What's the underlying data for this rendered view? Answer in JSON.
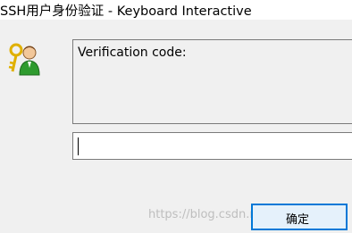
{
  "window": {
    "title": "SSH用户身份验证 - Keyboard Interactive"
  },
  "prompt": {
    "label": "Verification code:"
  },
  "code_input": {
    "value": ""
  },
  "buttons": {
    "ok_label": "确定"
  },
  "watermark": {
    "text": "https://blog.csdn.net/eyeofeagle"
  },
  "icons": {
    "auth_icon": "key-user-icon"
  },
  "colors": {
    "button_border": "#0078d7",
    "button_fill": "#e5f1fb",
    "user_green": "#2e9b2e",
    "key_gold": "#e0b000"
  }
}
